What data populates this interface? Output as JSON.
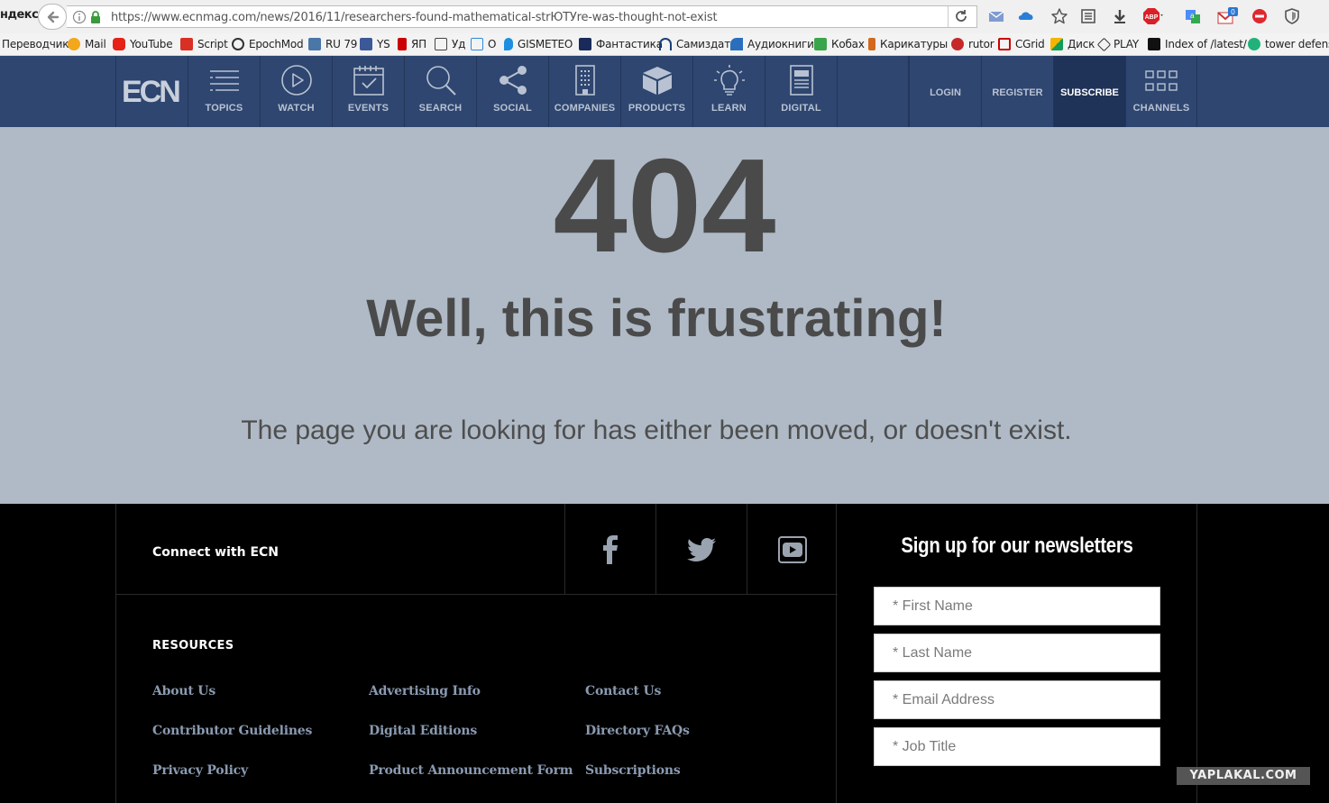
{
  "browser": {
    "brand_fragment": "ндекс",
    "url": "https://www.ecnmag.com/news/2016/11/researchers-found-mathematical-strЮТУre-was-thought-not-exist",
    "badge_count": "0",
    "adblock_badge": "ABP"
  },
  "bookmarks": [
    {
      "label": "Переводчик",
      "color": "#f0f0f0"
    },
    {
      "label": "Mail",
      "color": "#f2a81a"
    },
    {
      "label": "YouTube",
      "color": "#e62117"
    },
    {
      "label": "Script",
      "color": "#d93025"
    },
    {
      "label": "EpochMod",
      "color": "#333333"
    },
    {
      "label": "RU 79",
      "color": "#4a76a8"
    },
    {
      "label": "YS",
      "color": "#3b5998"
    },
    {
      "label": "ЯП",
      "color": "#cc0000"
    },
    {
      "label": "Уд",
      "color": "#444444"
    },
    {
      "label": "О",
      "color": "#2b8be0"
    },
    {
      "label": "GISMETEO",
      "color": "#1d8fe1"
    },
    {
      "label": "Фантастика",
      "color": "#1a2a5a"
    },
    {
      "label": "Самиздат",
      "color": "#1c3f7a"
    },
    {
      "label": "Аудиокниги",
      "color": "#2a6fbd"
    },
    {
      "label": "Кобах",
      "color": "#3aa64a"
    },
    {
      "label": "Карикатуры",
      "color": "#d2691e"
    },
    {
      "label": "rutor",
      "color": "#c62828"
    },
    {
      "label": "CGrid",
      "color": "#cc0000"
    },
    {
      "label": "Диск",
      "color": "#f4b400"
    },
    {
      "label": "PLAY",
      "color": "#333333"
    },
    {
      "label": "Index of /latest/",
      "color": "#111111"
    },
    {
      "label": "tower defense",
      "color": "#20b27a"
    }
  ],
  "nav": {
    "logo": "ECN",
    "items": [
      {
        "label": "TOPICS",
        "icon": "list-icon"
      },
      {
        "label": "WATCH",
        "icon": "play-icon"
      },
      {
        "label": "EVENTS",
        "icon": "calendar-icon"
      },
      {
        "label": "SEARCH",
        "icon": "search-icon"
      },
      {
        "label": "SOCIAL",
        "icon": "share-icon"
      },
      {
        "label": "COMPANIES",
        "icon": "building-icon"
      },
      {
        "label": "PRODUCTS",
        "icon": "box-icon"
      },
      {
        "label": "LEARN",
        "icon": "lightbulb-icon"
      },
      {
        "label": "DIGITAL",
        "icon": "document-icon"
      }
    ],
    "login": "LOGIN",
    "register": "REGISTER",
    "subscribe": "SUBSCRIBE",
    "channels": "CHANNELS"
  },
  "error": {
    "code": "404",
    "title": "Well, this is frustrating!",
    "message": "The page you are looking for has either been moved, or doesn't exist."
  },
  "footer": {
    "connect_label": "Connect with ECN",
    "resources_heading": "RESOURCES",
    "links": [
      [
        "About Us",
        "Advertising Info",
        "Contact Us"
      ],
      [
        "Contributor Guidelines",
        "Digital Editions",
        "Directory FAQs"
      ],
      [
        "Privacy Policy",
        "Product Announcement Form",
        "Subscriptions"
      ]
    ],
    "newsletter": {
      "title": "Sign up for our newsletters",
      "first_name": "* First Name",
      "last_name": "* Last Name",
      "email": "* Email Address",
      "job_title": "* Job Title"
    }
  },
  "watermark": "YAPLAKAL.COM"
}
